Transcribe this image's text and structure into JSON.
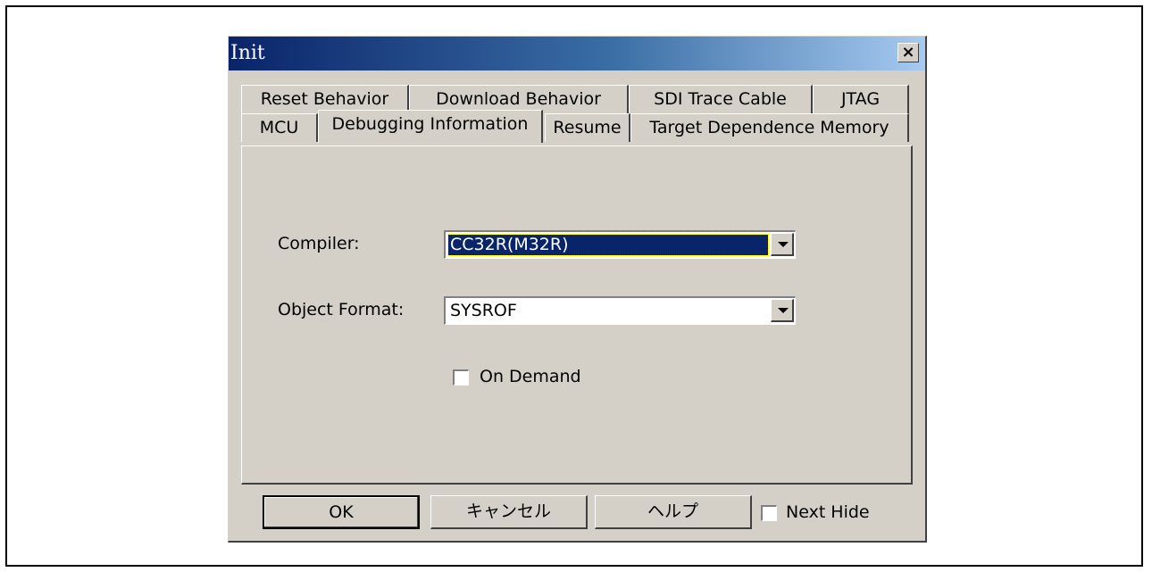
{
  "dialog": {
    "title": "Init",
    "close_label": "×"
  },
  "tabs_row1": [
    {
      "label": "Reset Behavior"
    },
    {
      "label": "Download Behavior"
    },
    {
      "label": "SDI Trace Cable"
    },
    {
      "label": "JTAG"
    }
  ],
  "tabs_row2": [
    {
      "label": "MCU"
    },
    {
      "label": "Debugging Information",
      "active": true
    },
    {
      "label": "Resume"
    },
    {
      "label": "Target Dependence Memory"
    }
  ],
  "form": {
    "compiler_label": "Compiler:",
    "compiler_value": "CC32R(M32R)",
    "object_format_label": "Object Format:",
    "object_format_value": "SYSROF",
    "on_demand_label": "On Demand",
    "on_demand_checked": false
  },
  "buttons": {
    "ok": "OK",
    "cancel": "キャンセル",
    "help": "ヘルプ",
    "next_hide_label": "Next Hide",
    "next_hide_checked": false
  },
  "colors": {
    "title_gradient_start": "#0a246a",
    "title_gradient_end": "#a6caf0",
    "face": "#d4d0c8",
    "selection": "#0a246a"
  }
}
